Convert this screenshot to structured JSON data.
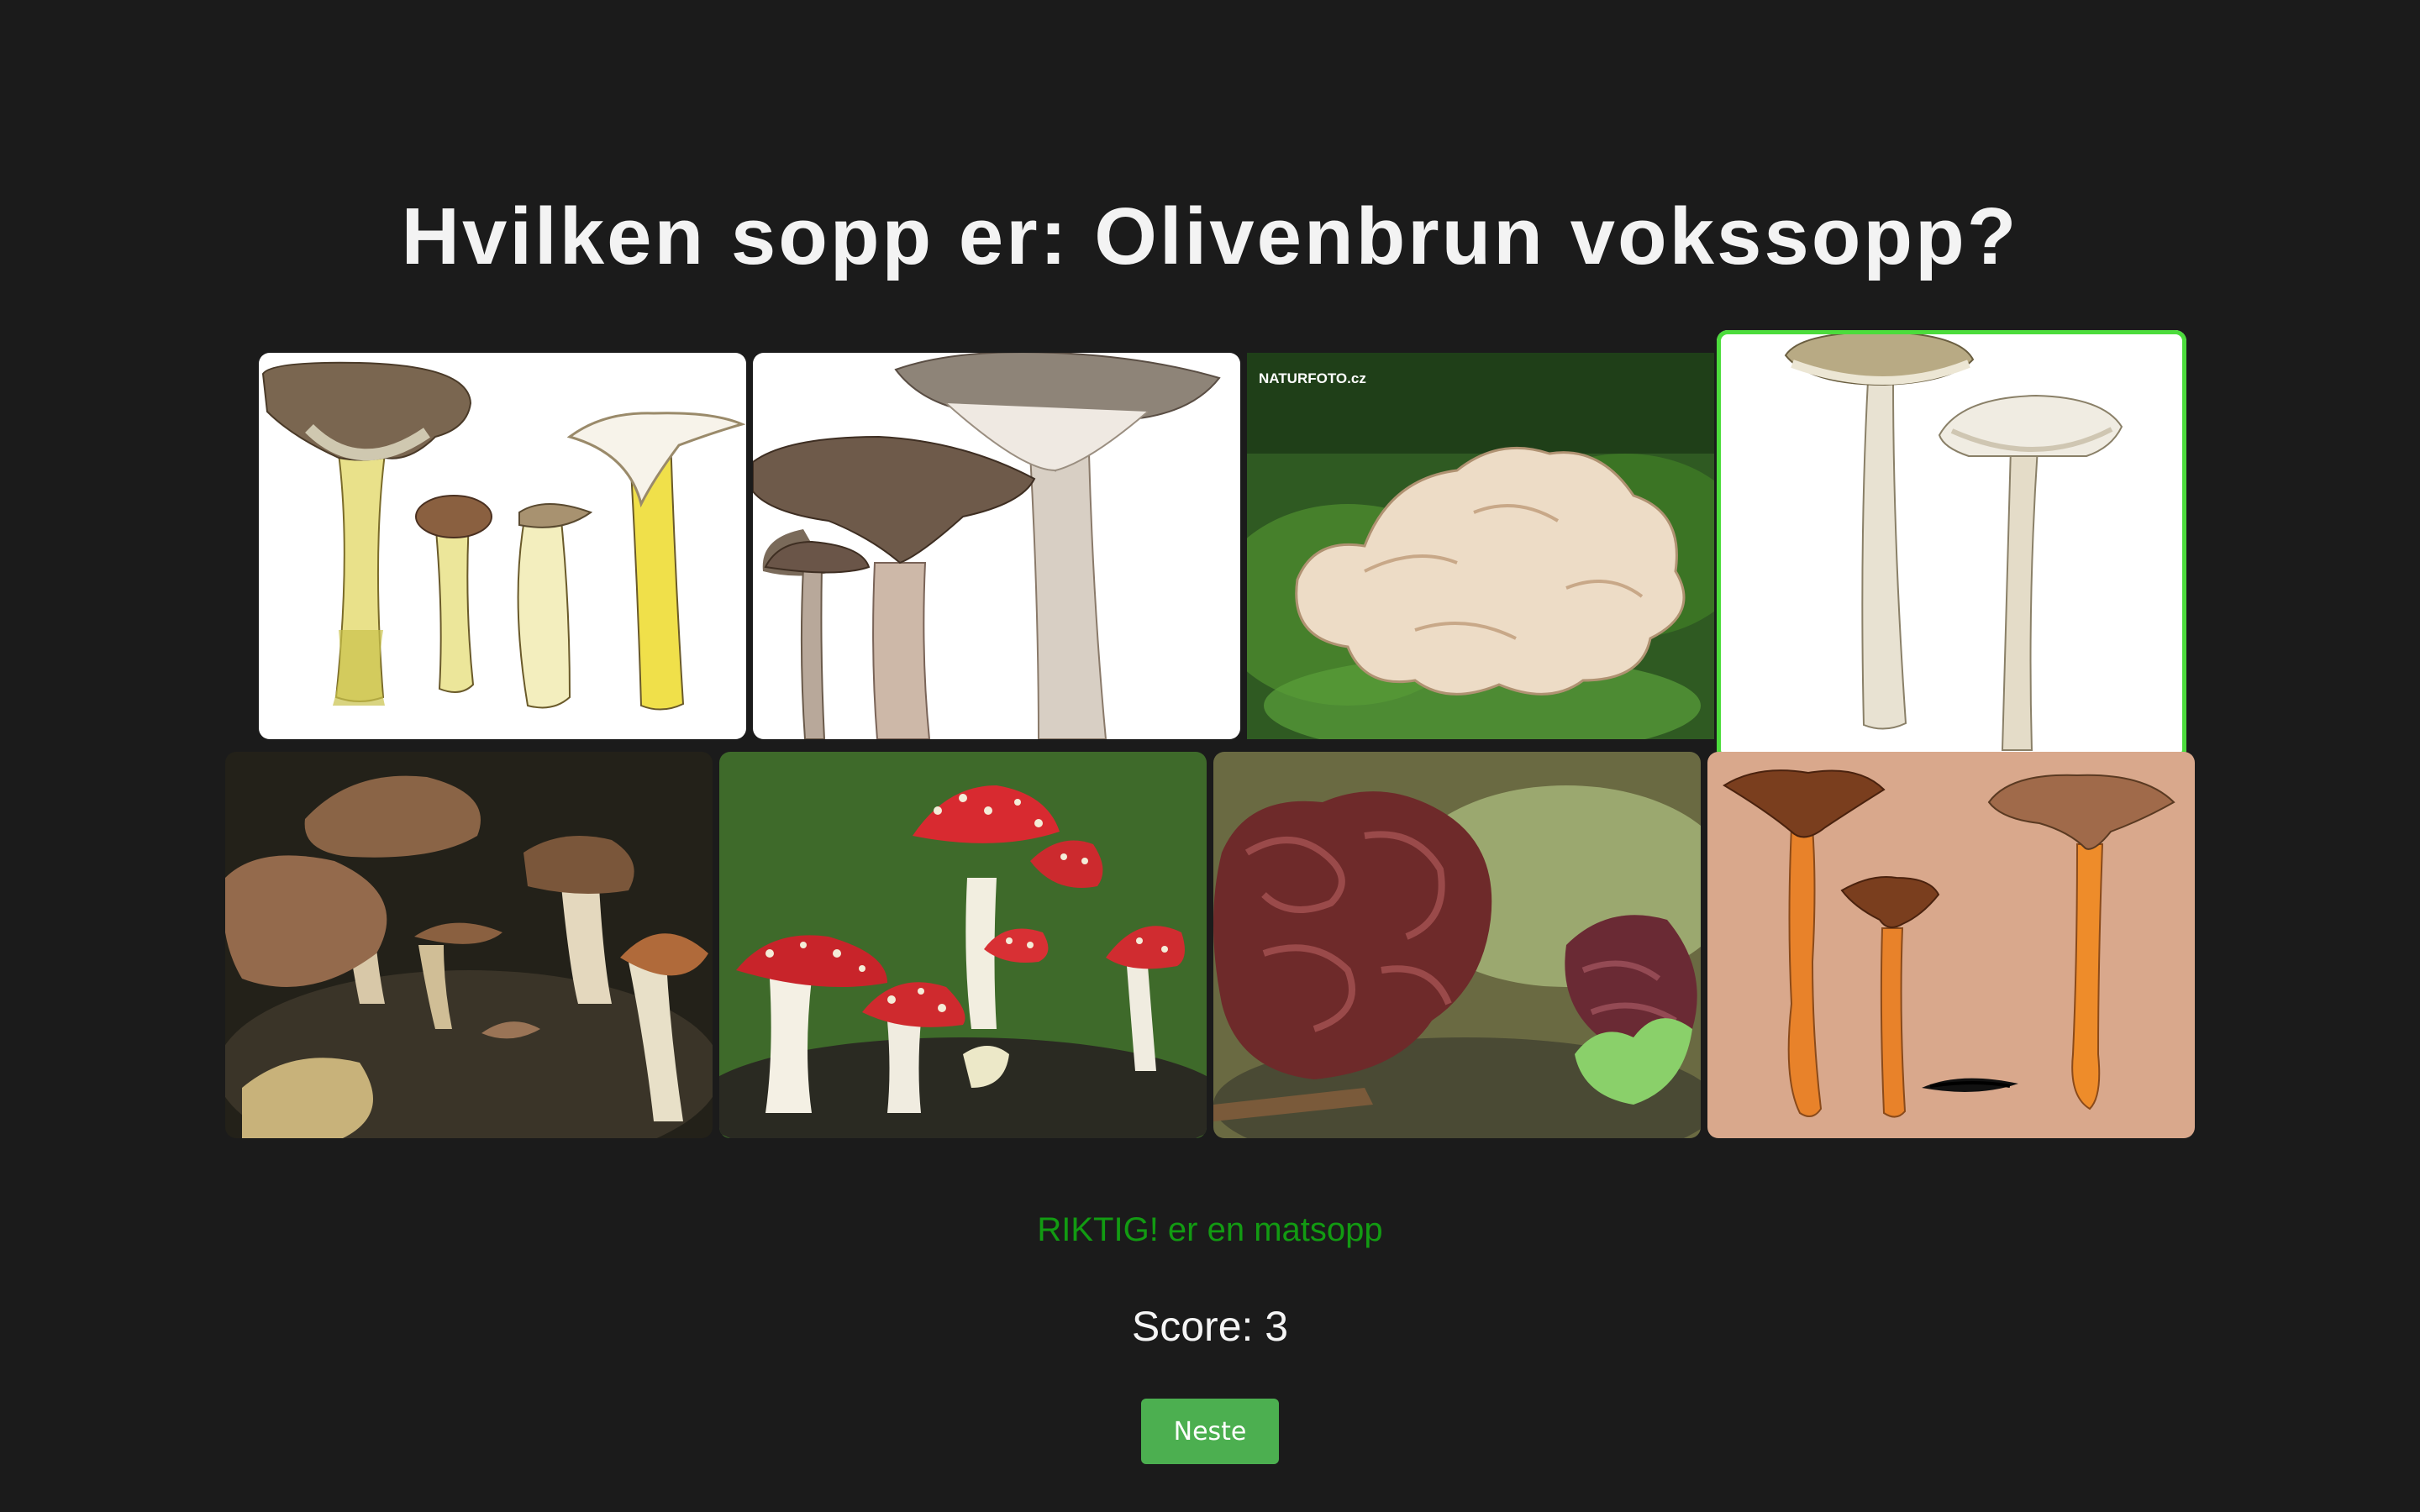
{
  "question": "Hvilken sopp er: Olivenbrun vokssopp?",
  "images": [
    {
      "subject": "illustration of four mushrooms with yellow stems",
      "selected": false
    },
    {
      "subject": "illustration of large grey-brown funnel mushrooms",
      "selected": false
    },
    {
      "subject": "photo of pale frilled fungus on moss",
      "selected": false,
      "watermark": "NATURFOTO.cz"
    },
    {
      "subject": "illustration of two slender pale mushrooms",
      "selected": true
    },
    {
      "subject": "photo of brown capped mushrooms on dark soil",
      "selected": false
    },
    {
      "subject": "photo of red fly agaric mushrooms",
      "selected": false
    },
    {
      "subject": "photo of brain-like false morel",
      "selected": false
    },
    {
      "subject": "illustration of orange-stemmed funnel mushrooms",
      "selected": false
    }
  ],
  "feedback": "RIKTIG! er en matsopp",
  "score_text": "Score: 3",
  "next_button_label": "Neste",
  "colors": {
    "background": "#1b1b1b",
    "correct_text": "#129b12",
    "selected_outline": "#4cdc3c",
    "button": "#4caf50"
  }
}
